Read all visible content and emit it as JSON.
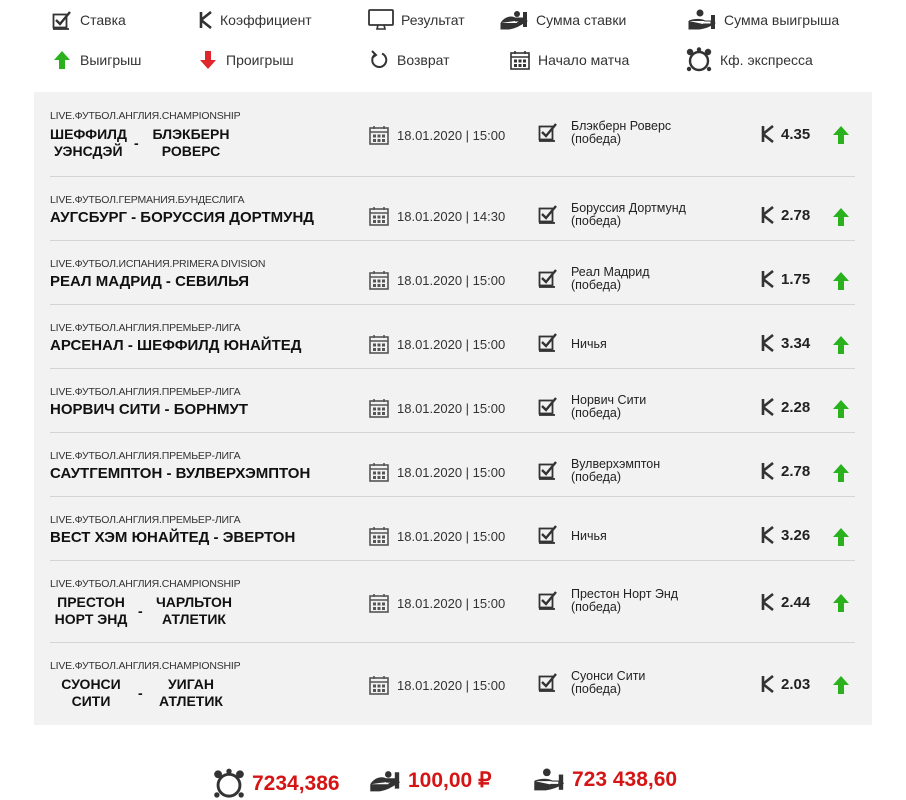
{
  "legend": {
    "stake": "Ставка",
    "coefficient": "Коэффициент",
    "result": "Результат",
    "stake_sum": "Сумма ставки",
    "win_sum": "Сумма выигрыша",
    "win": "Выигрыш",
    "loss": "Проигрыш",
    "refund": "Возврат",
    "match_start": "Начало матча",
    "express_coef": "Кф. экспресса"
  },
  "bets": [
    {
      "league": "LIVE.ФУТБОЛ.АНГЛИЯ.CHAMPIONSHIP",
      "home": "ШЕФФИЛД УЭНСДЭЙ",
      "home_l1": "ШЕФФИЛД",
      "home_l2": "УЭНСДЭЙ",
      "away": "БЛЭКБЕРН РОВЕРС",
      "away_l1": "БЛЭКБЕРН",
      "away_l2": "РОВЕРС",
      "separator": "-",
      "date": "18.01.2020 | 15:00",
      "result_l1": "Блэкберн Роверс",
      "result_l2": "(победа)",
      "coef": "4.35",
      "status": "win"
    },
    {
      "league": "LIVE.ФУТБОЛ.ГЕРМАНИЯ.БУНДЕСЛИГА",
      "match": "АУГСБУРГ - БОРУССИЯ ДОРТМУНД",
      "date": "18.01.2020 | 14:30",
      "result_l1": "Боруссия Дортмунд",
      "result_l2": "(победа)",
      "coef": "2.78",
      "status": "win"
    },
    {
      "league": "LIVE.ФУТБОЛ.ИСПАНИЯ.PRIMERA DIVISION",
      "match": "РЕАЛ МАДРИД - СЕВИЛЬЯ",
      "date": "18.01.2020 | 15:00",
      "result_l1": "Реал Мадрид",
      "result_l2": "(победа)",
      "coef": "1.75",
      "status": "win"
    },
    {
      "league": "LIVE.ФУТБОЛ.АНГЛИЯ.ПРЕМЬЕР-ЛИГА",
      "match": "АРСЕНАЛ - ШЕФФИЛД ЮНАЙТЕД",
      "date": "18.01.2020 | 15:00",
      "result_l1": "Ничья",
      "result_l2": "",
      "coef": "3.34",
      "status": "win"
    },
    {
      "league": "LIVE.ФУТБОЛ.АНГЛИЯ.ПРЕМЬЕР-ЛИГА",
      "match": "НОРВИЧ СИТИ - БОРНМУТ",
      "date": "18.01.2020 | 15:00",
      "result_l1": "Норвич Сити",
      "result_l2": "(победа)",
      "coef": "2.28",
      "status": "win"
    },
    {
      "league": "LIVE.ФУТБОЛ.АНГЛИЯ.ПРЕМЬЕР-ЛИГА",
      "match": "САУТГЕМПТОН - ВУЛВЕРХЭМПТОН",
      "date": "18.01.2020 | 15:00",
      "result_l1": "Вулверхэмптон",
      "result_l2": "(победа)",
      "coef": "2.78",
      "status": "win"
    },
    {
      "league": "LIVE.ФУТБОЛ.АНГЛИЯ.ПРЕМЬЕР-ЛИГА",
      "match": "ВЕСТ ХЭМ ЮНАЙТЕД - ЭВЕРТОН",
      "date": "18.01.2020 | 15:00",
      "result_l1": "Ничья",
      "result_l2": "",
      "coef": "3.26",
      "status": "win"
    },
    {
      "league": "LIVE.ФУТБОЛ.АНГЛИЯ.CHAMPIONSHIP",
      "home": "ПРЕСТОН НОРТ ЭНД",
      "home_l1": "ПРЕСТОН",
      "home_l2": "НОРТ ЭНД",
      "away": "ЧАРЛЬТОН АТЛЕТИК",
      "away_l1": "ЧАРЛЬТОН",
      "away_l2": "АТЛЕТИК",
      "separator": "-",
      "date": "18.01.2020 | 15:00",
      "result_l1": "Престон Норт Энд",
      "result_l2": "(победа)",
      "coef": "2.44",
      "status": "win"
    },
    {
      "league": "LIVE.ФУТБОЛ.АНГЛИЯ.CHAMPIONSHIP",
      "home": "СУОНСИ СИТИ",
      "home_l1": "СУОНСИ",
      "home_l2": "СИТИ",
      "away": "УИГАН АТЛЕТИК",
      "away_l1": "УИГАН",
      "away_l2": "АТЛЕТИК",
      "separator": "-",
      "date": "18.01.2020 | 15:00",
      "result_l1": "Суонси Сити",
      "result_l2": "(победа)",
      "coef": "2.03",
      "status": "win"
    }
  ],
  "summary": {
    "express_coef": "7234,386",
    "stake": "100,00 ₽",
    "payout": "723 438,60"
  },
  "colors": {
    "win": "#2bb11d",
    "loss": "#e0262d",
    "accent_red": "#d51515",
    "panel_bg": "#f2f2f2"
  }
}
